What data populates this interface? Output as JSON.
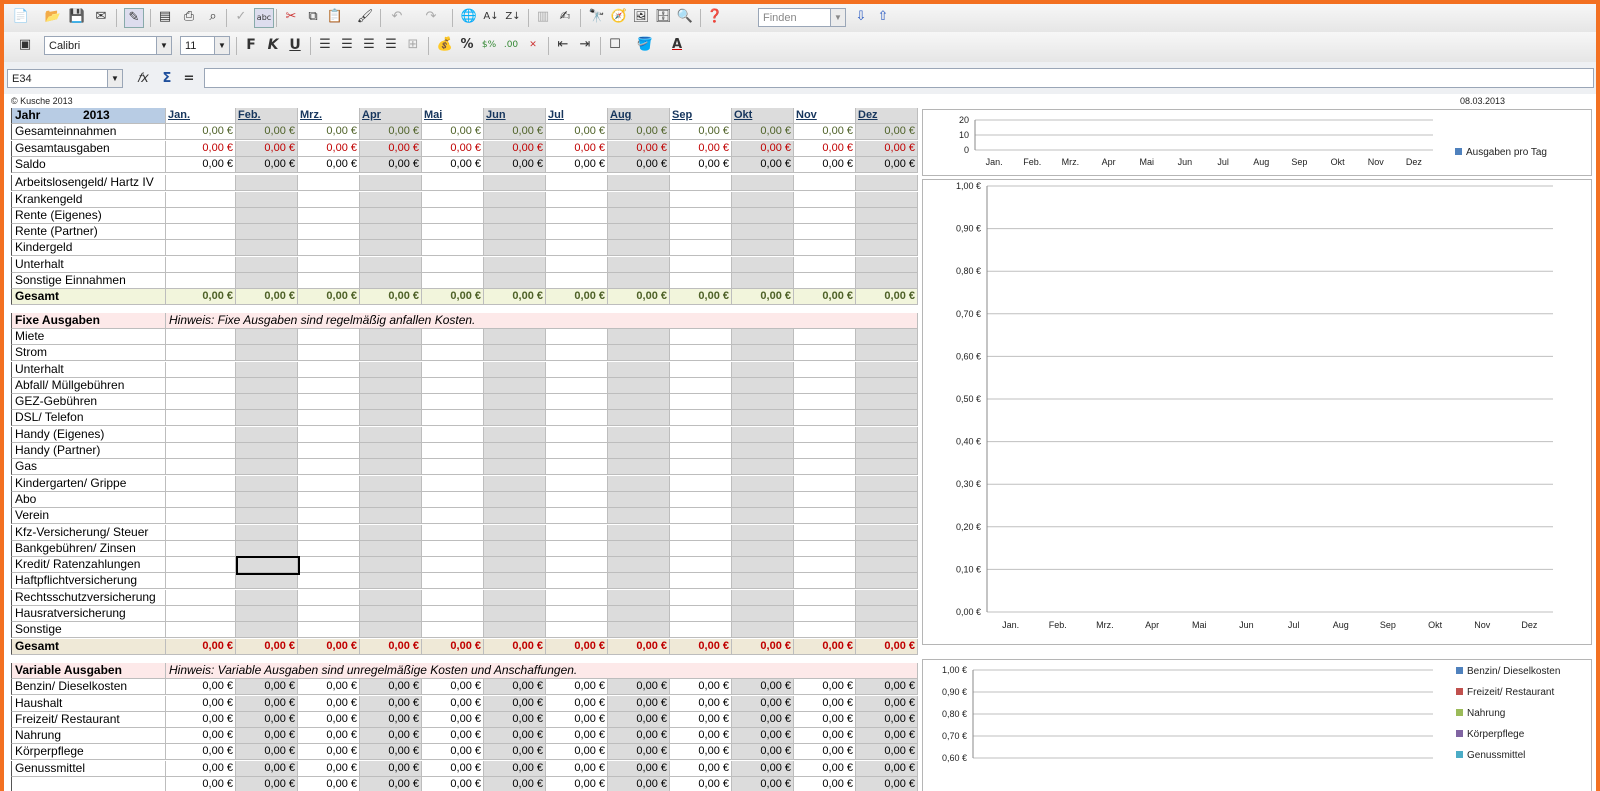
{
  "toolbar2": {
    "font": "Calibri",
    "font_size": "11",
    "bold": "F",
    "italic": "K",
    "underline": "U",
    "percent": "%",
    "font_color": "A"
  },
  "toolbar1": {
    "find_placeholder": "Finden"
  },
  "formula_bar": {
    "name_box": "E34",
    "fx": "𝑓x",
    "sigma": "Σ",
    "equals": "="
  },
  "sheet": {
    "copyright": "© Kusche 2013",
    "date": "08.03.2013",
    "year_label": "Jahr",
    "year": "2013",
    "months": [
      "Jan.",
      "Feb.",
      "Mrz.",
      "Apr",
      "Mai",
      "Jun",
      "Jul",
      "Aug",
      "Sep",
      "Okt",
      "Nov",
      "Dez"
    ],
    "zero": "0,00 €",
    "summary_rows": [
      {
        "label": "Gesamteinnahmen",
        "color": "green"
      },
      {
        "label": "Gesamtausgaben",
        "color": "red"
      },
      {
        "label": "Saldo",
        "color": "black"
      }
    ],
    "income_rows": [
      "Arbeitslosengeld/ Hartz IV",
      "Krankengeld",
      "Rente (Eigenes)",
      "Rente (Partner)",
      "Kindergeld",
      "Unterhalt",
      "Sonstige Einnahmen"
    ],
    "income_total": "Gesamt",
    "fixed_title": "Fixe Ausgaben",
    "fixed_hint": "Hinweis: Fixe Ausgaben sind regelmäßig anfallen Kosten.",
    "fixed_rows": [
      "Miete",
      "Strom",
      "Unterhalt",
      "Abfall/ Müllgebühren",
      "GEZ-Gebühren",
      "DSL/ Telefon",
      "Handy (Eigenes)",
      "Handy (Partner)",
      "Gas",
      "Kindergarten/ Grippe",
      "Abo",
      "Verein",
      "Kfz-Versicherung/ Steuer",
      "Bankgebühren/ Zinsen",
      "Kredit/ Ratenzahlungen",
      "Haftpflichtversicherung",
      "Rechtsschutzversicherung",
      "Hausratversicherung",
      "Sonstige"
    ],
    "fixed_total": "Gesamt",
    "variable_title": "Variable Ausgaben",
    "variable_hint": "Hinweis: Variable Ausgaben sind unregelmäßige Kosten und Anschaffungen.",
    "variable_rows": [
      "Benzin/ Dieselkosten",
      "Haushalt",
      "Freizeit/ Restaurant",
      "Nahrung",
      "Körperpflege",
      "Genussmittel"
    ]
  },
  "chart_data": [
    {
      "type": "bar",
      "categories": [
        "Jan.",
        "Feb.",
        "Mrz.",
        "Apr",
        "Mai",
        "Jun",
        "Jul",
        "Aug",
        "Sep",
        "Okt",
        "Nov",
        "Dez"
      ],
      "series": [
        {
          "name": "Ausgaben pro Tag",
          "values": [
            0,
            0,
            0,
            0,
            0,
            0,
            0,
            0,
            0,
            0,
            0,
            0
          ],
          "color": "#4f81bd"
        }
      ],
      "yticks": [
        "20",
        "10",
        "0"
      ],
      "ylim": [
        0,
        20
      ],
      "grid": true,
      "legend": "right"
    },
    {
      "type": "bar",
      "categories": [
        "Jan.",
        "Feb.",
        "Mrz.",
        "Apr",
        "Mai",
        "Jun",
        "Jul",
        "Aug",
        "Sep",
        "Okt",
        "Nov",
        "Dez"
      ],
      "series": [],
      "yticks": [
        "1,00 €",
        "0,90 €",
        "0,80 €",
        "0,70 €",
        "0,60 €",
        "0,50 €",
        "0,40 €",
        "0,30 €",
        "0,20 €",
        "0,10 €",
        "0,00 €"
      ],
      "ylim": [
        0,
        1
      ],
      "grid": true
    },
    {
      "type": "bar",
      "series": [
        {
          "name": "Benzin/ Dieselkosten",
          "values": [
            0,
            0,
            0,
            0,
            0,
            0,
            0,
            0,
            0,
            0,
            0,
            0
          ],
          "color": "#4f81bd"
        },
        {
          "name": "Freizeit/ Restaurant",
          "values": [
            0,
            0,
            0,
            0,
            0,
            0,
            0,
            0,
            0,
            0,
            0,
            0
          ],
          "color": "#c0504d"
        },
        {
          "name": "Nahrung",
          "values": [
            0,
            0,
            0,
            0,
            0,
            0,
            0,
            0,
            0,
            0,
            0,
            0
          ],
          "color": "#9bbb59"
        },
        {
          "name": "Körperpflege",
          "values": [
            0,
            0,
            0,
            0,
            0,
            0,
            0,
            0,
            0,
            0,
            0,
            0
          ],
          "color": "#8064a2"
        },
        {
          "name": "Genussmittel",
          "values": [
            0,
            0,
            0,
            0,
            0,
            0,
            0,
            0,
            0,
            0,
            0,
            0
          ],
          "color": "#4bacc6"
        }
      ],
      "yticks": [
        "1,00 €",
        "0,90 €",
        "0,80 €",
        "0,70 €",
        "0,60 €"
      ],
      "ylim": [
        0,
        1
      ],
      "grid": true,
      "legend": "right"
    }
  ]
}
